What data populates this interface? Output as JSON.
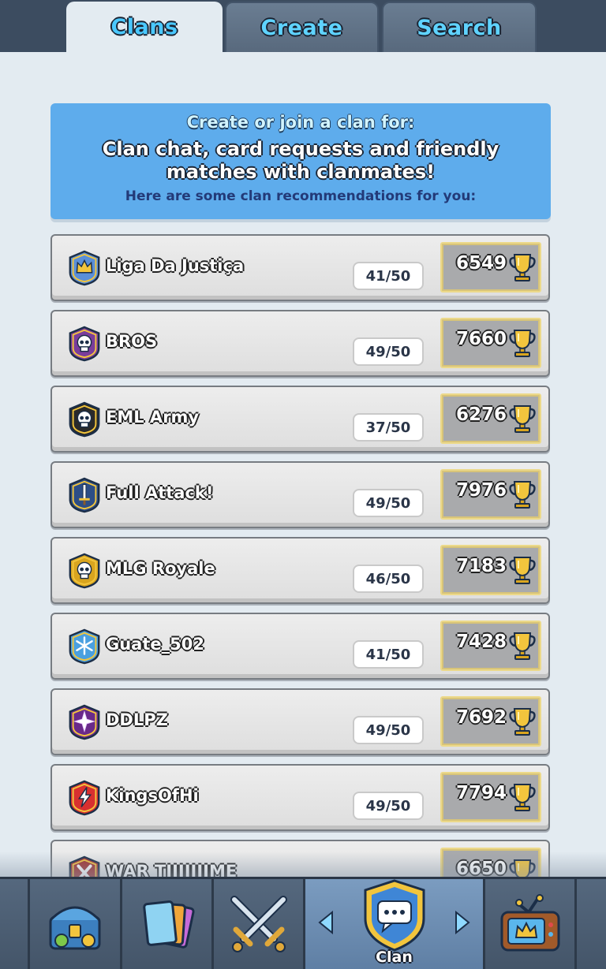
{
  "tabs": [
    {
      "label": "Clans",
      "active": true
    },
    {
      "label": "Create",
      "active": false
    },
    {
      "label": "Search",
      "active": false
    }
  ],
  "info": {
    "line1": "Create or join a clan for:",
    "line2": "Clan chat, card requests and friendly matches with clanmates!",
    "line3": "Here are some clan recommendations for you:"
  },
  "clans": [
    {
      "name": "Liga Da Justiça",
      "members": "41/50",
      "trophies": "6549",
      "badge": "crown-badge",
      "badge_color": "#5a8fd8"
    },
    {
      "name": "BROS",
      "members": "49/50",
      "trophies": "7660",
      "badge": "skull-badge",
      "badge_color": "#7b3d9b"
    },
    {
      "name": "EML Army",
      "members": "37/50",
      "trophies": "6276",
      "badge": "skull-badge",
      "badge_color": "#2a2a2a"
    },
    {
      "name": "Full Attack!",
      "members": "49/50",
      "trophies": "7976",
      "badge": "sword-badge",
      "badge_color": "#2d4e86"
    },
    {
      "name": "MLG Royale",
      "members": "46/50",
      "trophies": "7183",
      "badge": "skull-badge",
      "badge_color": "#d9a51f"
    },
    {
      "name": "Guate_502",
      "members": "41/50",
      "trophies": "7428",
      "badge": "snowflake-badge",
      "badge_color": "#4aa0e0"
    },
    {
      "name": "DDLPZ",
      "members": "49/50",
      "trophies": "7692",
      "badge": "star-badge",
      "badge_color": "#6a2a8a"
    },
    {
      "name": "KingsOfHi",
      "members": "49/50",
      "trophies": "7794",
      "badge": "lightning-badge",
      "badge_color": "#d83030"
    },
    {
      "name": "WAR TIIIIIIIME",
      "members": "",
      "trophies": "6650",
      "badge": "cross-badge",
      "badge_color": "#a03030"
    }
  ],
  "nav": {
    "items": [
      "chest-icon",
      "cards-icon",
      "battle-icon",
      "clan-chat-icon",
      "tv-royale-icon"
    ],
    "active_label": "Clan"
  },
  "colors": {
    "accent": "#5eacec",
    "tab_text": "#4ac8ff",
    "nav_active": "#7b9cc0"
  }
}
